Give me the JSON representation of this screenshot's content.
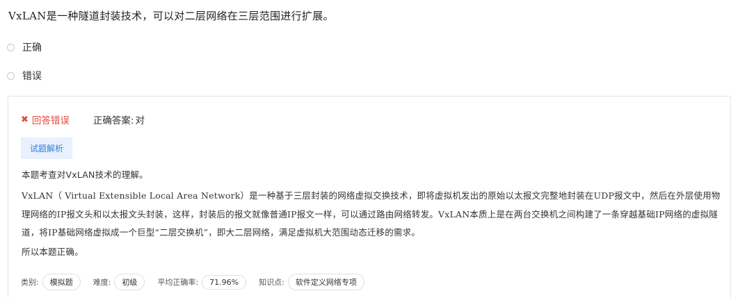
{
  "question": {
    "text": "VxLAN是一种隧道封装技术，可以对二层网络在三层范围进行扩展。"
  },
  "options": [
    {
      "label": "正确",
      "selected": false
    },
    {
      "label": "错误",
      "selected": false
    }
  ],
  "result": {
    "status_icon": "close-icon",
    "status_text": "回答错误",
    "status_color": "#e64b3c",
    "answer_label": "正确答案:",
    "answer_value": "对"
  },
  "analysis": {
    "tab_label": "试题解析",
    "paragraph1": "本题考查对VxLAN技术的理解。",
    "paragraph2": "VxLAN（ Virtual Extensible Local Area Network）是一种基于三层封装的网络虚拟交换技术，即将虚拟机发出的原始以太报文完整地封装在UDP报文中，然后在外层使用物理网络的IP报文头和以太报文头封装，这样，封装后的报文就像普通IP报文一样，可以通过路由网络转发。VxLAN本质上是在两台交换机之间构建了一条穿越基础IP网络的虚拟隧道，将IP基础网络虚拟成一个巨型“二层交换机”，即大二层网络，满足虚拟机大范围动态迁移的需求。",
    "paragraph3": "所以本题正确。"
  },
  "meta": {
    "category_label": "类别:",
    "category_value": "模拟题",
    "difficulty_label": "难度:",
    "difficulty_value": "初级",
    "accuracy_label": "平均正确率:",
    "accuracy_value": "71.96%",
    "knowledge_label": "知识点:",
    "knowledge_value": "软件定义网络专项"
  },
  "colors": {
    "accent": "#3a7bd5",
    "tab_bg": "#e8f1fd",
    "error": "#e64b3c"
  }
}
